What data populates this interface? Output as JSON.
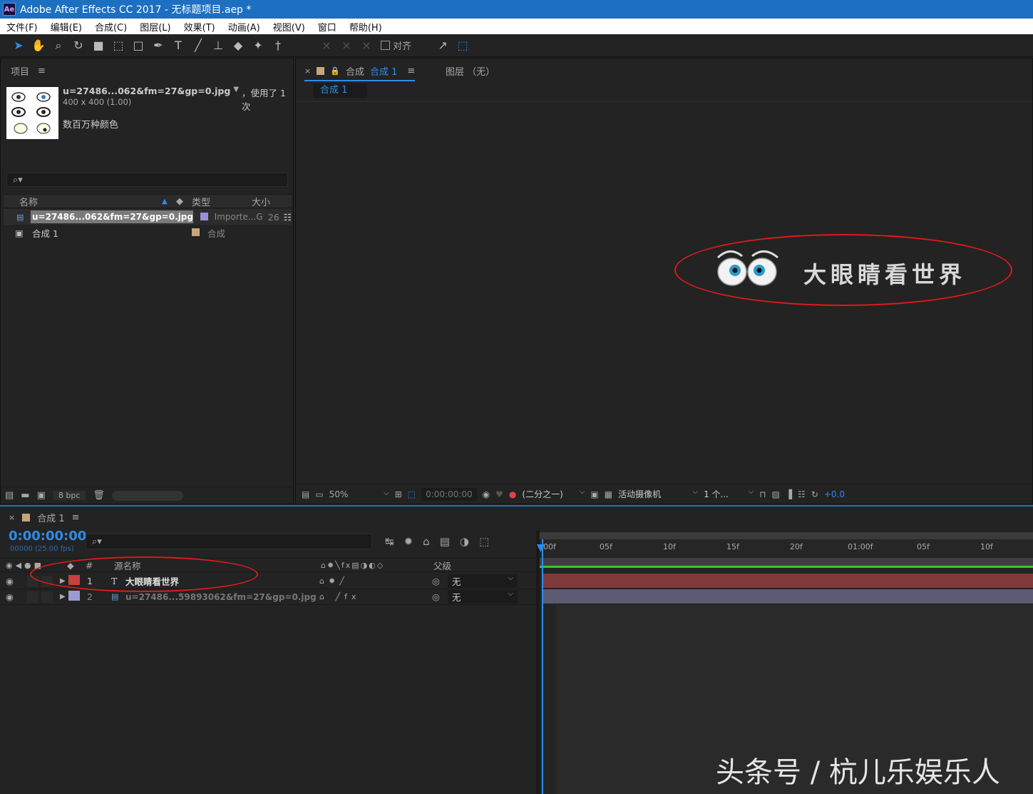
{
  "app": {
    "title": "Adobe After Effects CC 2017 - 无标题项目.aep *",
    "logo": "Ae"
  },
  "menu": [
    "文件(F)",
    "编辑(E)",
    "合成(C)",
    "图层(L)",
    "效果(T)",
    "动画(A)",
    "视图(V)",
    "窗口",
    "帮助(H)"
  ],
  "toolbar": {
    "snap_label": "对齐"
  },
  "project": {
    "tab": "项目",
    "preview": {
      "name": "u=27486...062&fm=27&gp=0.jpg",
      "usage": "，使用了 1 次",
      "dims": "400 x 400 (1.00)",
      "colors": "数百万种颜色"
    },
    "columns": {
      "name": "名称",
      "type": "类型",
      "size": "大小"
    },
    "items": [
      {
        "name": "u=27486...062&fm=27&gp=0.jpg",
        "type": "Importe...G",
        "size": "26",
        "color": "#9c8fd6"
      },
      {
        "name": "合成 1",
        "type": "合成",
        "size": "",
        "color": "#c7a57a"
      }
    ],
    "bpc": "8 bpc"
  },
  "viewer": {
    "tab_prefix": "合成",
    "tab_comp": "合成 1",
    "layer_tab": "图层 （无）",
    "breadcrumb": "合成 1",
    "graphic_text": "大眼睛看世界",
    "footer": {
      "zoom": "50%",
      "timecode": "0:00:00:00",
      "resolution": "(二分之一)",
      "camera": "活动摄像机",
      "views": "1 个...",
      "exposure": "+0.0"
    }
  },
  "timeline": {
    "tab": "合成 1",
    "timecode": "0:00:00:00",
    "frames": "00000 (25.00 fps)",
    "columns": {
      "num": "#",
      "source": "源名称",
      "parent": "父级"
    },
    "ruler": [
      "00f",
      "05f",
      "10f",
      "15f",
      "20f",
      "01:00f",
      "05f",
      "10f"
    ],
    "layers": [
      {
        "num": "1",
        "type": "T",
        "name": "大眼睛看世界",
        "parent": "无",
        "color": "#c94040",
        "bar": "#7e3a3a"
      },
      {
        "num": "2",
        "type": "img",
        "name": "u=27486...59893062&fm=27&gp=0.jpg",
        "parent": "无",
        "color": "#9c9bd0",
        "bar": "#5b5a72"
      }
    ]
  },
  "watermark": "头条号 / 杭儿乐娱乐人",
  "colors": {
    "accent": "#2d8ceb",
    "titlebar": "#1c6fc1",
    "annotation": "#e01a1a"
  }
}
